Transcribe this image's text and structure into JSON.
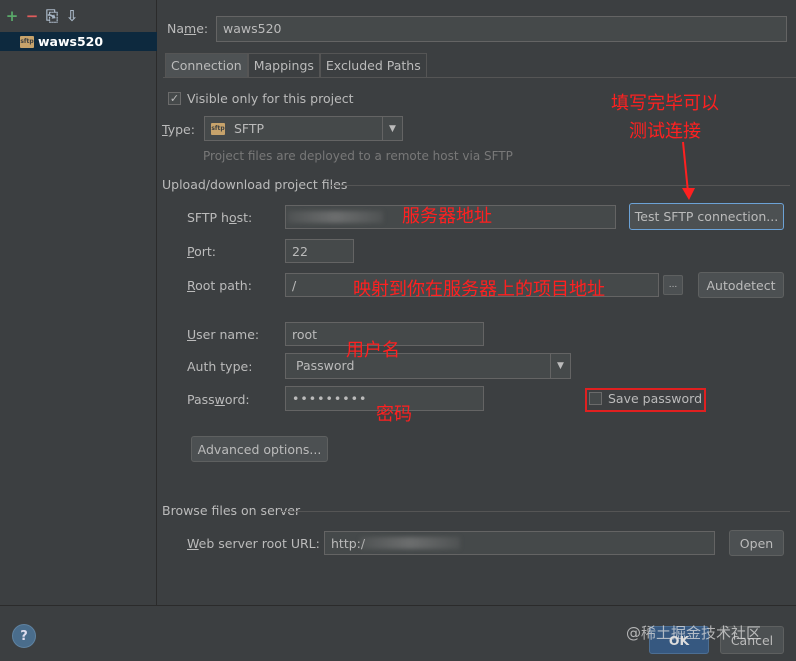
{
  "left_panel": {
    "toolbar": {
      "add": "+",
      "remove": "−",
      "copy": "⎘",
      "move": "⇩"
    },
    "tree_item": {
      "icon": "sftp-icon",
      "label": "waws520"
    }
  },
  "form": {
    "name_label": "Name:",
    "name_value": "waws520",
    "tabs": [
      "Connection",
      "Mappings",
      "Excluded Paths"
    ],
    "visible_only_label": "Visible only for this project",
    "visible_only_checked": true,
    "type_label": "Type:",
    "type_value": "SFTP",
    "type_desc": "Project files are deployed to a remote host via SFTP",
    "upload_section": "Upload/download project files",
    "sftp_host_label": "SFTP host:",
    "sftp_host_value": "",
    "test_button": "Test SFTP connection...",
    "port_label": "Port:",
    "port_value": "22",
    "root_path_label": "Root path:",
    "root_path_value": "/",
    "ellipsis": "...",
    "autodetect_button": "Autodetect",
    "user_name_label": "User name:",
    "user_name_value": "root",
    "auth_type_label": "Auth type:",
    "auth_type_value": "Password",
    "password_label": "Password:",
    "password_value": "•••••••••",
    "save_password_label": "Save password",
    "save_password_checked": false,
    "advanced_button": "Advanced options...",
    "browse_section": "Browse files on server",
    "web_root_label": "Web server root URL:",
    "web_root_value": "http:/",
    "open_button": "Open"
  },
  "footer": {
    "help": "?",
    "ok_button": "OK",
    "cancel_button": "Cancel"
  },
  "annotations": {
    "test_hint": "填写完毕可以\n测试连接",
    "host_hint": "服务器地址",
    "root_hint": "映射到你在服务器上的项目地址",
    "user_hint": "用户名",
    "password_hint": "密码"
  },
  "watermark": "@稀土掘金技术社区",
  "colors": {
    "background": "#3c3f41",
    "selection": "#0d293e",
    "annotation": "#ff2020",
    "focus_border": "#6ca2d6"
  }
}
